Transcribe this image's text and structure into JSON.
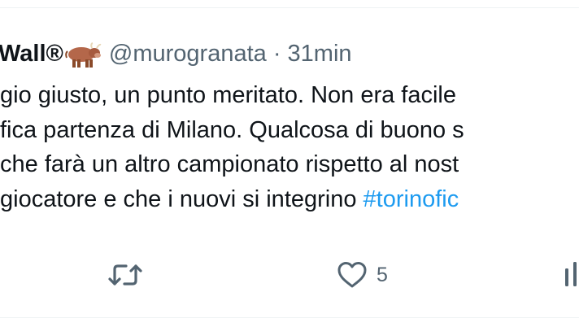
{
  "tweet": {
    "display_name": "Wall®",
    "emoji": "ox-emoji",
    "handle_time": "@murogranata · 31min",
    "lines": [
      {
        "text": "gio giusto, un punto meritato. Non era facile"
      },
      {
        "text": "fica partenza di Milano. Qualcosa di buono s"
      },
      {
        "text": "che farà un altro campionato rispetto al nost"
      },
      {
        "text": "giocatore e che i nuovi si integrino ",
        "hashtag": "#torinofic"
      }
    ]
  },
  "actions": {
    "retweet": {
      "icon": "retweet-icon",
      "count": ""
    },
    "like": {
      "icon": "heart-icon",
      "count": "5"
    },
    "views": {
      "icon": "views-icon",
      "count": ""
    }
  },
  "colors": {
    "text": "#0f1419",
    "secondary": "#536471",
    "link": "#1d9bf0",
    "divider": "#eff3f4"
  }
}
